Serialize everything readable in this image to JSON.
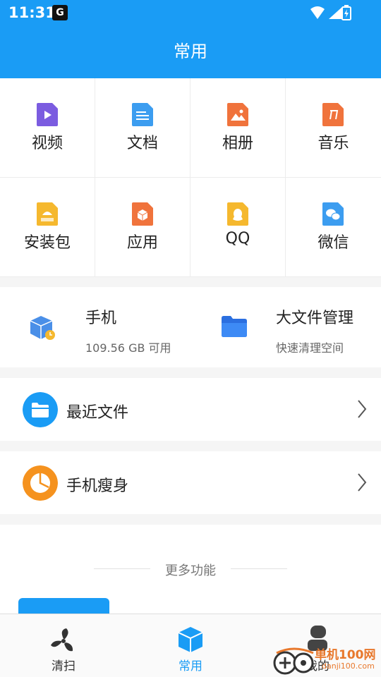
{
  "status": {
    "time": "11:31",
    "notif_glyph": "G"
  },
  "header": {
    "title": "常用"
  },
  "categories": [
    {
      "label": "视频",
      "icon": "video-file-icon",
      "color": "#7b5ce0"
    },
    {
      "label": "文档",
      "icon": "document-file-icon",
      "color": "#3c9df0"
    },
    {
      "label": "相册",
      "icon": "image-file-icon",
      "color": "#f0733c"
    },
    {
      "label": "音乐",
      "icon": "music-file-icon",
      "color": "#f0733c"
    },
    {
      "label": "安装包",
      "icon": "apk-file-icon",
      "color": "#f5b82e"
    },
    {
      "label": "应用",
      "icon": "app-file-icon",
      "color": "#f0733c"
    },
    {
      "label": "QQ",
      "icon": "qq-icon",
      "color": "#f5b82e"
    },
    {
      "label": "微信",
      "icon": "wechat-icon",
      "color": "#3c9df0"
    }
  ],
  "storage": {
    "phone": {
      "title": "手机",
      "sub": "109.56 GB 可用",
      "icon": "phone-storage-icon"
    },
    "large_files": {
      "title": "大文件管理",
      "sub": "快速清理空间",
      "icon": "folder-icon"
    }
  },
  "rows": [
    {
      "label": "最近文件",
      "icon": "recent-files-icon",
      "color": "#1a9cf5"
    },
    {
      "label": "手机瘦身",
      "icon": "slim-pie-icon",
      "color": "#f5921e"
    }
  ],
  "more": {
    "title": "更多功能"
  },
  "tabs": [
    {
      "label": "清扫",
      "icon": "fan-icon"
    },
    {
      "label": "常用",
      "icon": "cube-icon"
    },
    {
      "label": "我的",
      "icon": "person-icon"
    }
  ],
  "watermark": {
    "text": "单机100网",
    "url": "danji100.com"
  },
  "colors": {
    "accent": "#1a9cf5"
  }
}
